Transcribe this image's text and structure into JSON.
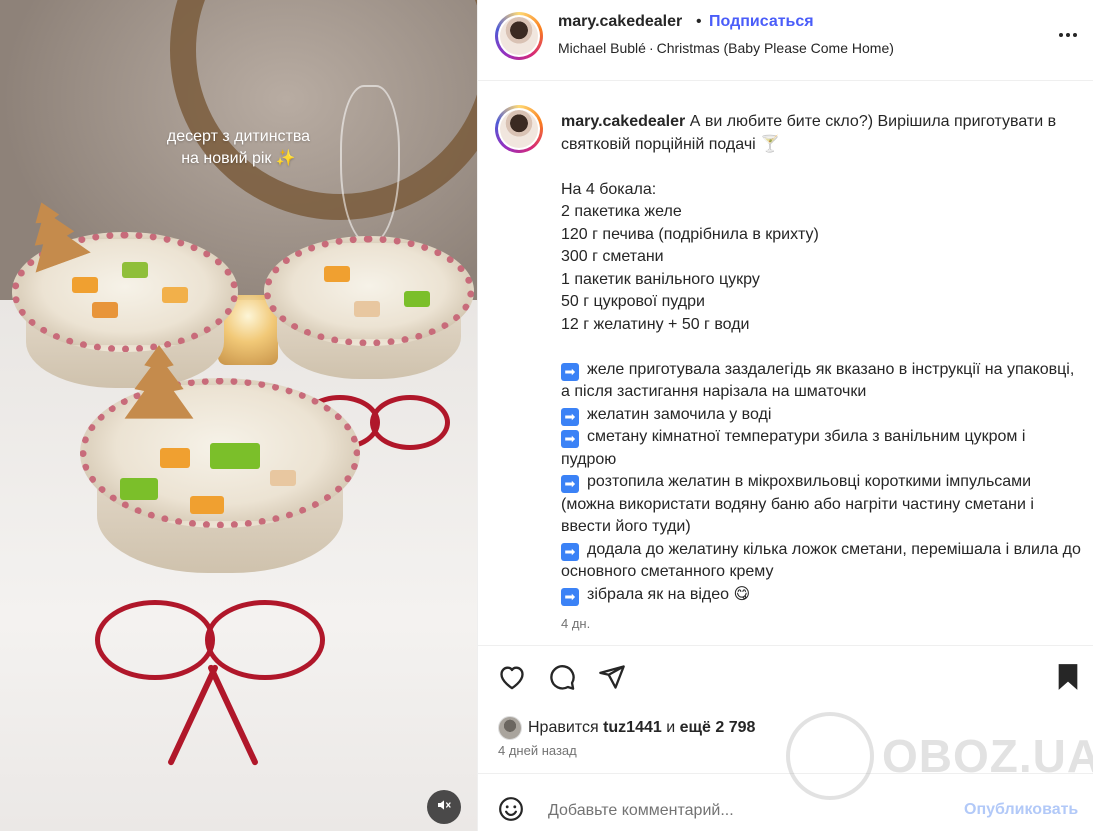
{
  "media": {
    "overlay_line1": "десерт з дитинства",
    "overlay_line2": "на новий рік ✨",
    "mute_icon": "speaker-muted-icon"
  },
  "header": {
    "username": "mary.cakedealer",
    "separator": "•",
    "follow_label": "Подписаться",
    "song_artist": "Michael Bublé",
    "song_separator": "·",
    "song_title": "Christmas (Baby Please Come Home)",
    "follow_color": "#4a5df9"
  },
  "caption": {
    "username": "mary.cakedealer",
    "intro": "А ви любите бите скло?) Вирішила приготувати в святковій порційній подачі 🍸",
    "ingredients_title": "На 4 бокала:",
    "ingredients": [
      "2 пакетика желе",
      "120 г печива (подрібнила в крихту)",
      "300 г сметани",
      "1 пакетик ванільного цукру",
      "50 г цукрової пудри",
      "12 г желатину + 50 г води"
    ],
    "steps": [
      "желе приготувала заздалегідь як вказано в інструкції на упаковці, а після застигання нарізала на шматочки",
      "желатин замочила у воді",
      "сметану кімнатної температури збила з ванільним цукром і пудрою",
      "розтопила желатин в мікрохвильовці короткими імпульсами (можна використати водяну баню або нагріти частину сметани і ввести його туди)",
      "додала до желатину кілька ложок сметани, перемішала і влила до основного сметанного крему",
      "зібрала як на відео 😋"
    ],
    "step_marker": "➡",
    "time": "4 дн."
  },
  "actions": {
    "like_icon": "heart-icon",
    "comment_icon": "comment-icon",
    "share_icon": "share-icon",
    "save_icon": "bookmark-icon",
    "likes_prefix": "Нравится",
    "likes_user": "tuz1441",
    "likes_and": "и",
    "likes_more": "ещё 2 798",
    "posted_when": "4 дней назад"
  },
  "comment": {
    "placeholder": "Добавьте комментарий...",
    "post_label": "Опубликовать",
    "emoji_icon": "smiley-icon"
  },
  "watermark": {
    "text": "OBOZ.UA"
  }
}
